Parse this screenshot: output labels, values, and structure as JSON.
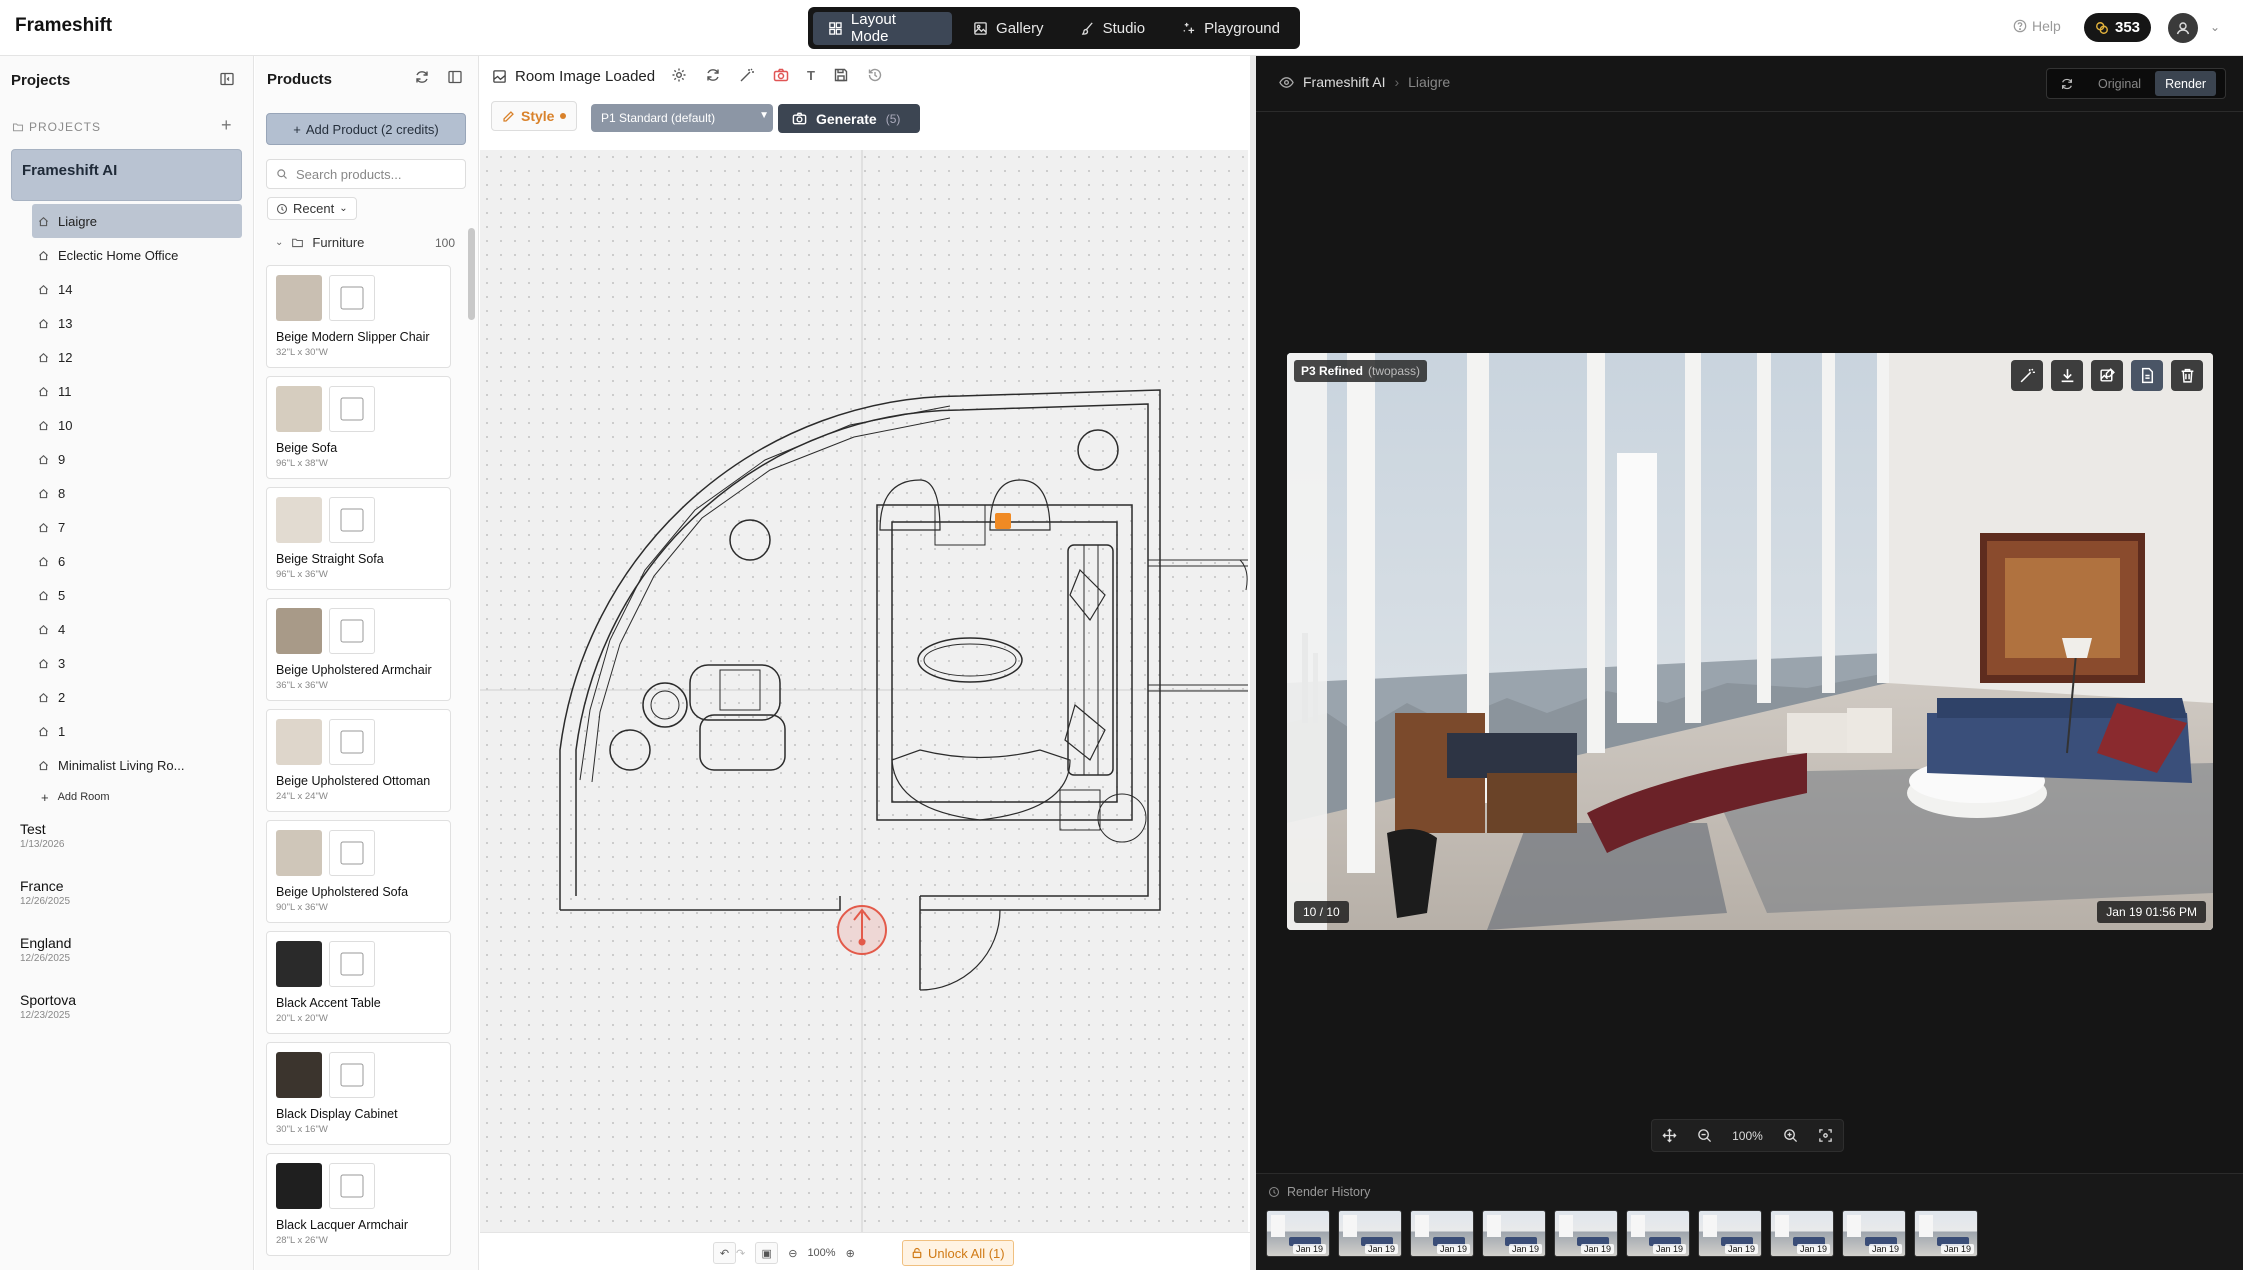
{
  "app": {
    "brand": "Frameshift"
  },
  "modes": [
    {
      "label": "Layout Mode",
      "icon": "grid-icon",
      "active": true
    },
    {
      "label": "Gallery",
      "icon": "image-icon",
      "active": false
    },
    {
      "label": "Studio",
      "icon": "brush-icon",
      "active": false
    },
    {
      "label": "Playground",
      "icon": "sparkles-icon",
      "active": false
    }
  ],
  "header": {
    "help": "Help",
    "credits": "353"
  },
  "sidebar": {
    "title": "Projects",
    "section_label": "PROJECTS",
    "active_project": "Frameshift AI",
    "rooms": [
      "Liaigre",
      "Eclectic Home Office",
      "14",
      "13",
      "12",
      "11",
      "10",
      "9",
      "8",
      "7",
      "6",
      "5",
      "4",
      "3",
      "2",
      "1",
      "Minimalist Living Ro..."
    ],
    "add_room": "Add Room",
    "other_projects": [
      {
        "name": "Test",
        "date": "1/13/2026"
      },
      {
        "name": "France",
        "date": "12/26/2025"
      },
      {
        "name": "England",
        "date": "12/26/2025"
      },
      {
        "name": "Sportova",
        "date": "12/23/2025"
      }
    ]
  },
  "products": {
    "title": "Products",
    "add_button": "Add Product (2 credits)",
    "search_placeholder": "Search products...",
    "sort": "Recent",
    "category": {
      "name": "Furniture",
      "count": "100"
    },
    "items": [
      {
        "name": "Beige Modern Slipper Chair",
        "dims": "32\"L x 30\"W",
        "color": "#c9bfb2"
      },
      {
        "name": "Beige Sofa",
        "dims": "96\"L x 38\"W",
        "color": "#d6cdbf"
      },
      {
        "name": "Beige Straight Sofa",
        "dims": "96\"L x 36\"W",
        "color": "#e2dbd1"
      },
      {
        "name": "Beige Upholstered Armchair",
        "dims": "36\"L x 36\"W",
        "color": "#a89a88"
      },
      {
        "name": "Beige Upholstered Ottoman",
        "dims": "24\"L x 24\"W",
        "color": "#ded6cb"
      },
      {
        "name": "Beige Upholstered Sofa",
        "dims": "90\"L x 36\"W",
        "color": "#cfc6b9"
      },
      {
        "name": "Black Accent Table",
        "dims": "20\"L x 20\"W",
        "color": "#2a2a2a"
      },
      {
        "name": "Black Display Cabinet",
        "dims": "30\"L x 16\"W",
        "color": "#3b342d"
      },
      {
        "name": "Black Lacquer Armchair",
        "dims": "28\"L x 26\"W",
        "color": "#1f1f1f"
      }
    ]
  },
  "canvas": {
    "title": "Room Image Loaded",
    "style_label": "Style",
    "preset": "P1 Standard (default)",
    "generate_label": "Generate",
    "generate_count": "(5)",
    "zoom": "100%",
    "unlock_label": "Unlock All (1)"
  },
  "viewer": {
    "project": "Frameshift AI",
    "room": "Liaigre",
    "toggle_original": "Original",
    "toggle_render": "Render",
    "badge_title": "P3 Refined",
    "badge_sub": "(twopass)",
    "counter": "10 / 10",
    "timestamp": "Jan 19 01:56 PM",
    "zoom": "100%",
    "history_label": "Render History",
    "history": [
      "Jan 19",
      "Jan 19",
      "Jan 19",
      "Jan 19",
      "Jan 19",
      "Jan 19",
      "Jan 19",
      "Jan 19",
      "Jan 19",
      "Jan 19"
    ]
  },
  "colors": {
    "accent_orange": "#d9822b",
    "dark": "#161616",
    "active_slate": "#3d4756"
  }
}
